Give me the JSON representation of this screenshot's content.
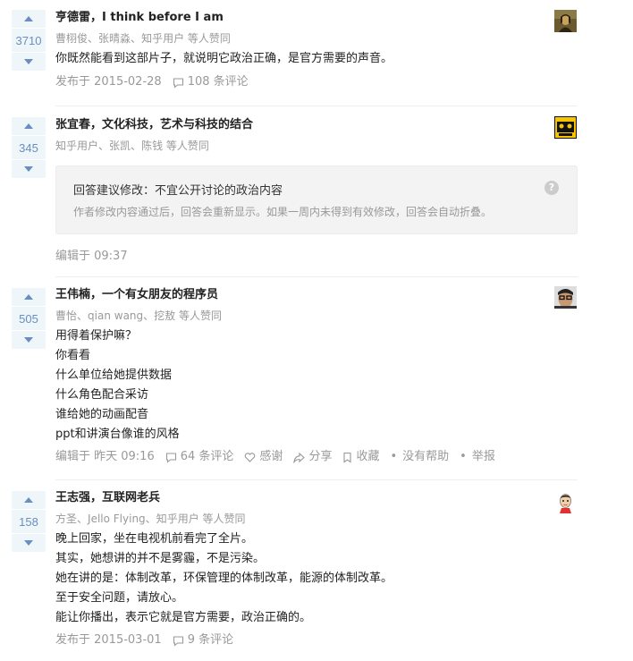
{
  "answers": [
    {
      "votes": "3710",
      "author": "亨德雷，I think before I am",
      "voters": [
        "曹栩俊",
        "张晴淼",
        "知乎用户"
      ],
      "voters_suffix": "等人赞同",
      "content": [
        "你既然能看到这部片子，就说明它政治正确，是官方需要的声音。"
      ],
      "date": "发布于 2015-02-28",
      "comments": "108 条评论",
      "avatar_icon": "mona-lisa-avatar"
    },
    {
      "votes": "345",
      "author": "张宜春，文化科技，艺术与科技的结合",
      "voters": [
        "知乎用户",
        "张凯",
        "陈钱"
      ],
      "voters_suffix": "等人赞同",
      "notice_title": "回答建议修改：不宜公开讨论的政治内容",
      "notice_desc": "作者修改内容通过后，回答会重新显示。如果一周内未得到有效修改，回答会自动折叠。",
      "date": "编辑于 09:37",
      "avatar_icon": "logo-avatar"
    },
    {
      "votes": "505",
      "author": "王伟楠，一个有女朋友的程序员",
      "voters": [
        "曹怡",
        "qian wang",
        "挖敖"
      ],
      "voters_suffix": "等人赞同",
      "content": [
        "用得着保护嘛？",
        "你看看",
        "什么单位给她提供数据",
        "什么角色配合采访",
        "谁给她的动画配音",
        "ppt和讲演台像谁的风格"
      ],
      "date": "编辑于 昨天 09:16",
      "comments": "64 条评论",
      "thanks": "感谢",
      "share": "分享",
      "collect": "收藏",
      "unhelpful": "没有帮助",
      "report": "举报",
      "avatar_icon": "glasses-man-avatar"
    },
    {
      "votes": "158",
      "author": "王志强，互联网老兵",
      "voters": [
        "方圣",
        "Jello Flying",
        "知乎用户"
      ],
      "voters_suffix": "等人赞同",
      "content": [
        "晚上回家，坐在电视机前看完了全片。",
        "其实，她想讲的并不是雾霾，不是污染。",
        "她在讲的是：体制改革，环保管理的体制改革，能源的体制改革。",
        "至于安全问题，请放心。",
        "能让你播出，表示它就是官方需要，政治正确的。"
      ],
      "date": "发布于 2015-03-01",
      "comments": "9 条评论",
      "avatar_icon": "cartoon-man-avatar"
    }
  ]
}
